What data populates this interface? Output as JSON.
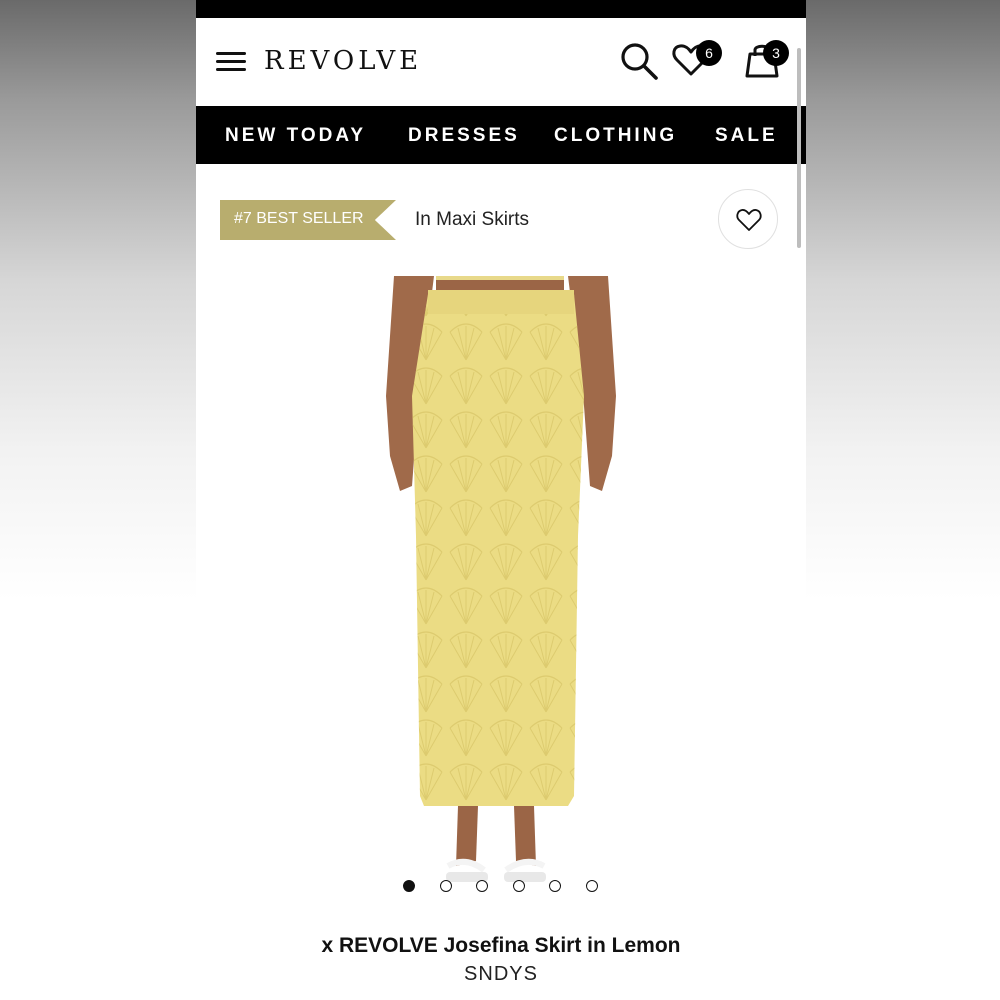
{
  "header": {
    "logo": "REVOLVE",
    "wishlist_count": "6",
    "bag_count": "3",
    "icons": [
      "menu-icon",
      "search-icon",
      "heart-icon",
      "shopping-bag-icon"
    ]
  },
  "nav": {
    "items": [
      "NEW TODAY",
      "DRESSES",
      "CLOTHING",
      "SALE"
    ]
  },
  "bestseller": {
    "badge": "#7 BEST SELLER",
    "category": "In Maxi Skirts"
  },
  "carousel": {
    "total": 6,
    "active_index": 0
  },
  "product": {
    "title": "x REVOLVE Josefina Skirt in Lemon",
    "brand": "SNDYS"
  },
  "colors": {
    "accent": "#b8ad6e",
    "skirt": "#ebdc84",
    "nav_bg": "#000000"
  }
}
